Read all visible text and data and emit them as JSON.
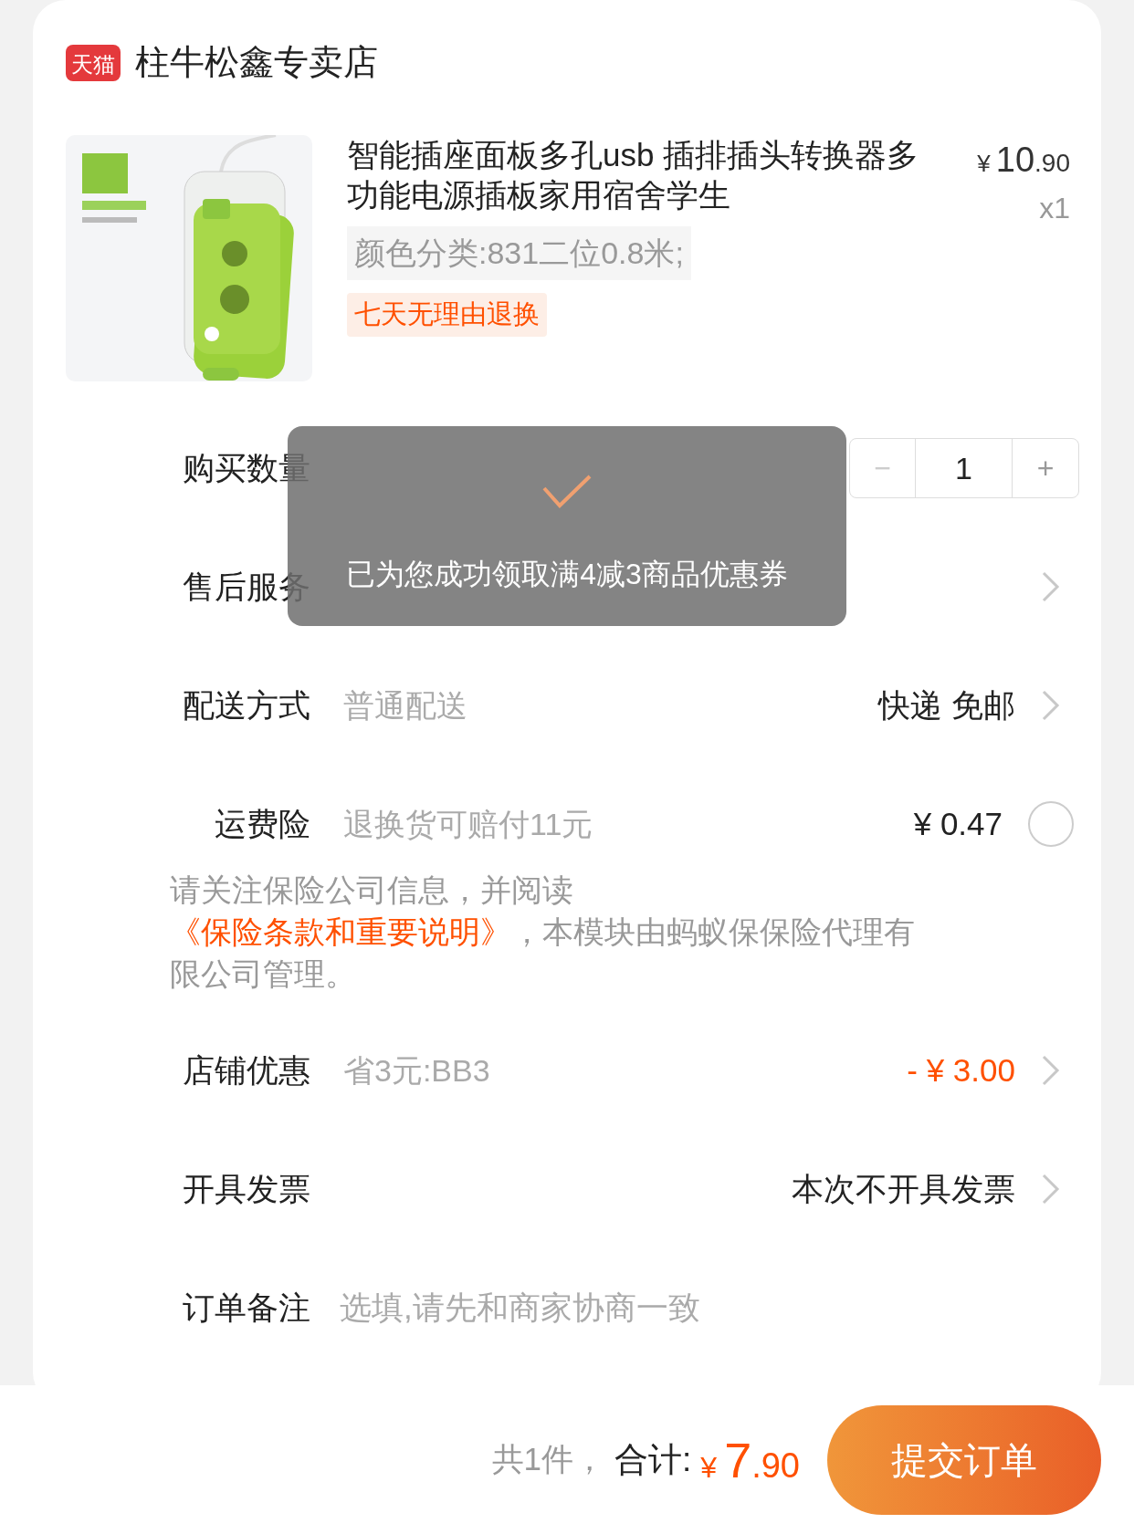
{
  "store": {
    "badge": "天猫",
    "name": "柱牛松鑫专卖店"
  },
  "product": {
    "title": "智能插座面板多孔usb 插排插头转换器多功能电源插板家用宿舍学生",
    "price_symbol": "¥",
    "price_int": "10",
    "price_dec": ".90",
    "quantity": "x1",
    "sku": "颜色分类:831二位0.8米;",
    "tag": "七天无理由退换"
  },
  "rows": [
    {
      "kind": "stepper",
      "label": "购买数量",
      "minus": "−",
      "value": "1",
      "plus": "+"
    },
    {
      "kind": "link",
      "label": "售后服务",
      "chevron": true
    },
    {
      "kind": "link",
      "label": "配送方式",
      "value": "普通配送",
      "right": "快递 免邮",
      "chevron": true
    },
    {
      "kind": "toggle",
      "label": "运费险",
      "value": "退换货可赔付11元",
      "right": "¥ 0.47",
      "checked": false
    },
    {
      "kind": "note",
      "before": "请关注保险公司信息，并阅读",
      "link": "《保险条款和重要说明》",
      "after": "，本模块由蚂蚁保保险代理有限公司管理。"
    },
    {
      "kind": "discount",
      "label": "店铺优惠",
      "value": "省3元:BB3",
      "right": "- ¥ 3.00",
      "chevron": true
    },
    {
      "kind": "link",
      "label": "开具发票",
      "right": "本次不开具发票",
      "chevron": true
    },
    {
      "kind": "input",
      "label": "订单备注",
      "placeholder": "选填,请先和商家协商一致"
    }
  ],
  "footer": {
    "count": "共1件，",
    "total_label": "合计:",
    "total_symbol": "¥",
    "total_int": "7",
    "total_dec": ".90",
    "submit": "提交订单"
  },
  "toast": {
    "message": "已为您成功领取满4减3商品优惠券"
  }
}
